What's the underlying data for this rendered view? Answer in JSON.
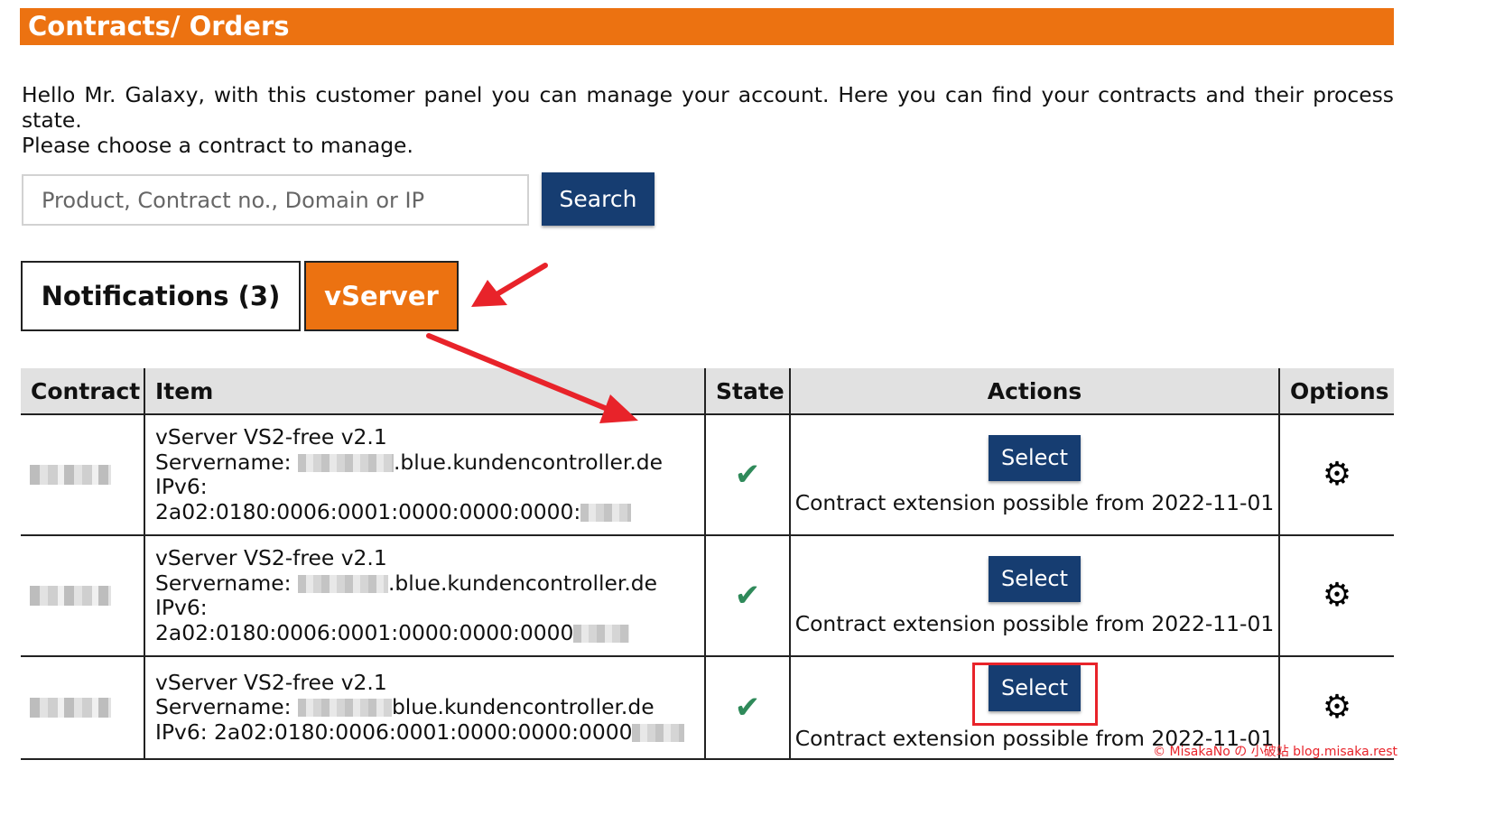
{
  "header": {
    "title": "Contracts/ Orders"
  },
  "intro": {
    "line1": "Hello Mr. Galaxy, with this customer panel you can manage your account. Here you can find your contracts and their process state.",
    "line2": "Please choose a contract to manage."
  },
  "search": {
    "placeholder": "Product, Contract no., Domain or IP",
    "value": "",
    "button_label": "Search"
  },
  "tabs": [
    {
      "label": "Notifications (3)",
      "active": false
    },
    {
      "label": "vServer",
      "active": true
    }
  ],
  "table": {
    "headers": [
      "Contract",
      "Item",
      "State",
      "Actions",
      "Options"
    ],
    "rows": [
      {
        "item_name": "vServer VS2-free v2.1",
        "servername_label": "Servername:",
        "servername_suffix": ".blue.kundencontroller.de",
        "ipv6_label": "IPv6:",
        "ipv6_prefix": "2a02:0180:0006:0001:0000:0000:0000:",
        "action_label": "Select",
        "extension_text": "Contract extension possible from 2022-11-01"
      },
      {
        "item_name": "vServer VS2-free v2.1",
        "servername_label": "Servername:",
        "servername_suffix": ".blue.kundencontroller.de",
        "ipv6_label": "IPv6:",
        "ipv6_prefix": "2a02:0180:0006:0001:0000:0000:0000",
        "action_label": "Select",
        "extension_text": "Contract extension possible from 2022-11-01"
      },
      {
        "item_name": "vServer VS2-free v2.1",
        "servername_label": "Servername:",
        "servername_suffix": "blue.kundencontroller.de",
        "ipv6_line": "IPv6: 2a02:0180:0006:0001:0000:0000:0000",
        "action_label": "Select",
        "extension_text": "Contract extension possible from 2022-11-01"
      }
    ]
  },
  "icons": {
    "state": "checkmark-icon",
    "options": "gear-icon"
  },
  "colors": {
    "accent": "#ec7211",
    "button": "#163d71",
    "annotation": "#e8232a",
    "check": "#2f8a5a"
  },
  "watermark": "© MisakaNo の 小破站 blog.misaka.rest"
}
